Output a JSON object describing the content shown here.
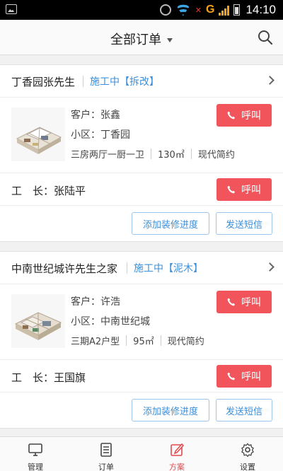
{
  "status_bar": {
    "time": "14:10",
    "carrier": "G"
  },
  "header": {
    "title": "全部订单"
  },
  "orders": [
    {
      "title": "丁香园张先生",
      "status": "施工中【拆改】",
      "customer": "客户：张鑫",
      "community": "小区：丁香园",
      "layout": "三房两厅一厨一卫",
      "area": "130㎡",
      "style": "现代简约",
      "call_label": "呼叫",
      "foreman_label": "工　长：张陆平",
      "foreman_call_label": "呼叫",
      "add_progress_label": "添加装修进度",
      "send_sms_label": "发送短信"
    },
    {
      "title": "中南世纪城许先生之家",
      "status": "施工中【泥木】",
      "customer": "客户：许浩",
      "community": "小区：中南世纪城",
      "layout": "三期A2户型",
      "area": "95㎡",
      "style": "现代简约",
      "call_label": "呼叫",
      "foreman_label": "工　长：王国旗",
      "foreman_call_label": "呼叫",
      "add_progress_label": "添加装修进度",
      "send_sms_label": "发送短信"
    }
  ],
  "tabs": [
    {
      "label": "管理",
      "icon": "monitor-icon"
    },
    {
      "label": "订单",
      "icon": "order-list-icon"
    },
    {
      "label": "方案",
      "icon": "edit-plan-icon",
      "active": true
    },
    {
      "label": "设置",
      "icon": "gear-icon"
    }
  ],
  "colors": {
    "accent": "#f2545b",
    "link": "#3c8fd8",
    "active_tab": "#e04a4f"
  }
}
